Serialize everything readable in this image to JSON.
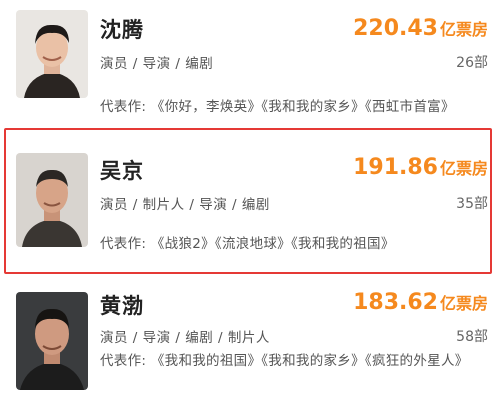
{
  "items": [
    {
      "name": "沈腾",
      "box_value": "220.43",
      "box_unit": "亿票房",
      "roles": "演员 / 导演 / 编剧",
      "films": "26部",
      "works": "代表作: 《你好，李焕英》《我和我的家乡》《西虹市首富》",
      "avatar_icon": "person-photo"
    },
    {
      "name": "吴京",
      "box_value": "191.86",
      "box_unit": "亿票房",
      "roles": "演员 / 制片人 / 导演 / 编剧",
      "films": "35部",
      "works": "代表作: 《战狼2》《流浪地球》《我和我的祖国》",
      "avatar_icon": "person-photo"
    },
    {
      "name": "黄渤",
      "box_value": "183.62",
      "box_unit": "亿票房",
      "roles": "演员 / 导演 / 编剧 / 制片人",
      "films": "58部",
      "works": "代表作: 《我和我的祖国》《我和我的家乡》《疯狂的外星人》",
      "avatar_icon": "person-photo"
    }
  ],
  "colors": {
    "accent": "#f5891e",
    "highlight": "#e53935"
  }
}
